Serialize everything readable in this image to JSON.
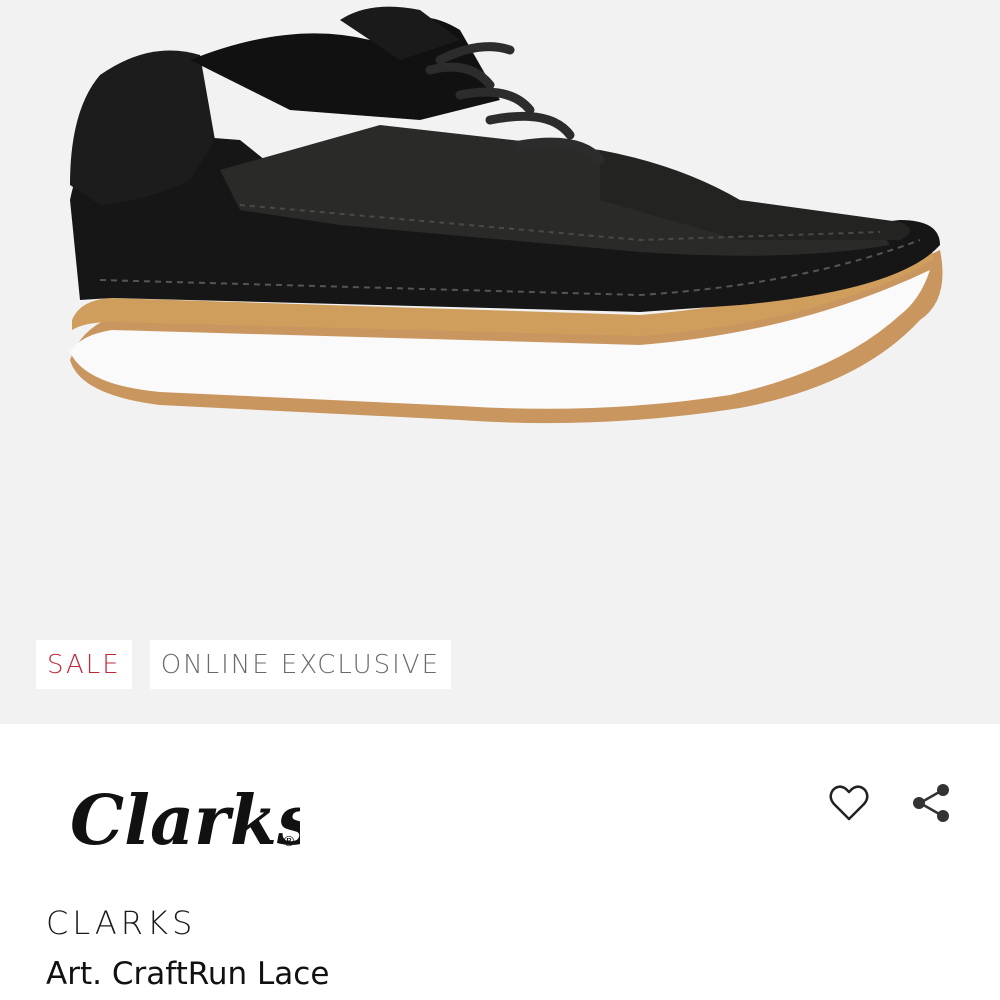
{
  "badges": {
    "sale": "SALE",
    "online": "ONLINE EXCLUSIVE"
  },
  "logo": {
    "text": "Clarks",
    "mark": "®"
  },
  "product": {
    "brand": "CLARKS",
    "name": "Art. CraftRun Lace"
  },
  "icons": {
    "wishlist": "heart-icon",
    "share": "share-icon"
  },
  "colors": {
    "sale": "#c0283a",
    "hero_background": "#f2f2f2"
  }
}
